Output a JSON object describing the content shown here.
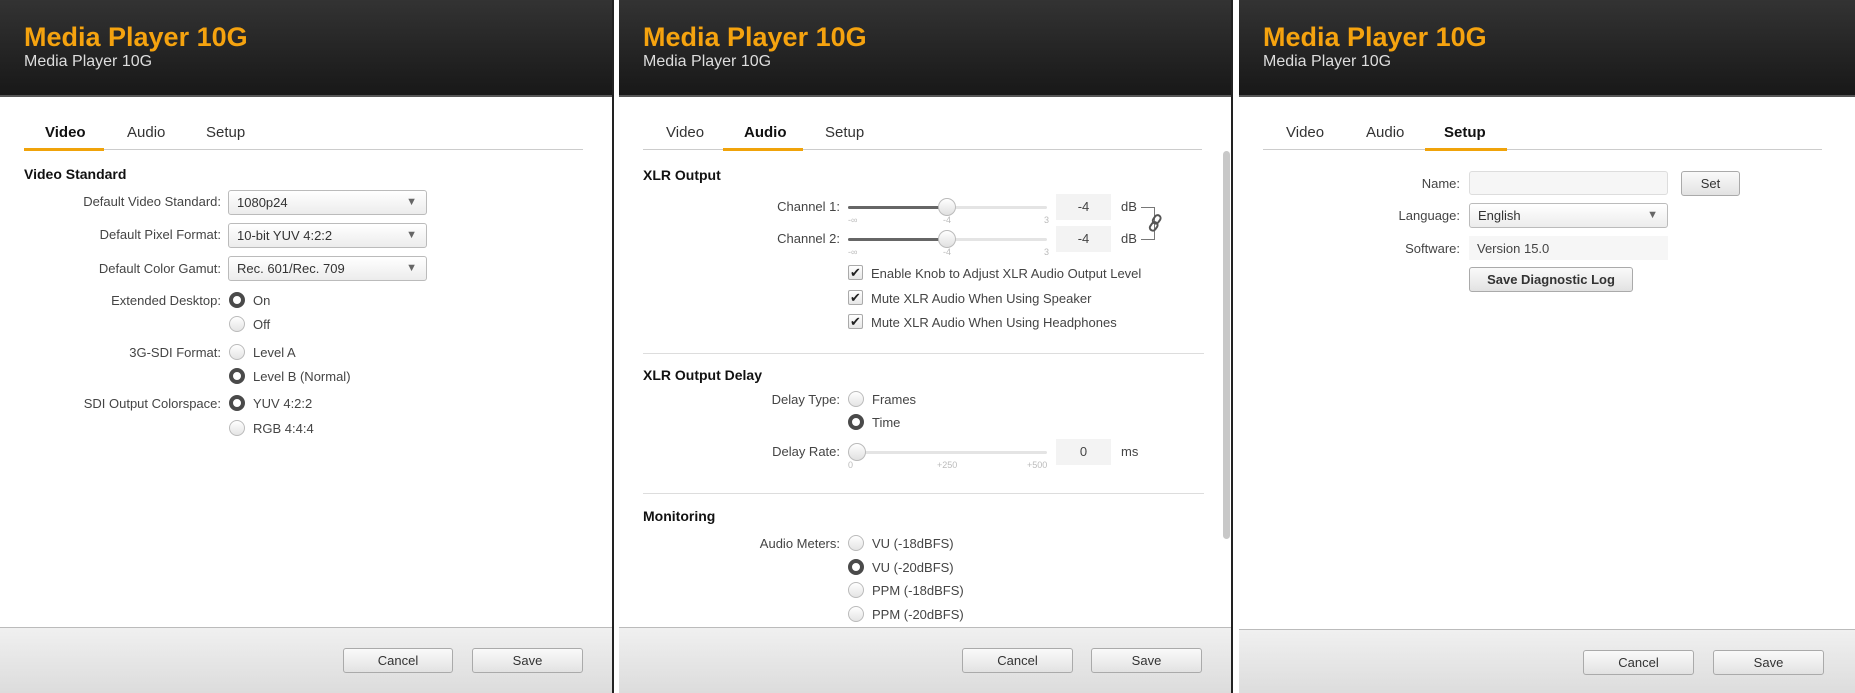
{
  "app": {
    "title": "Media Player 10G",
    "subtitle": "Media Player 10G"
  },
  "tabs": [
    "Video",
    "Audio",
    "Setup"
  ],
  "colors": {
    "accent": "#f0a30a",
    "header_bg": "#222222"
  },
  "footer": {
    "cancel": "Cancel",
    "save": "Save"
  },
  "video": {
    "section": "Video Standard",
    "default_video_standard": {
      "label": "Default Video Standard:",
      "value": "1080p24"
    },
    "default_pixel_format": {
      "label": "Default Pixel Format:",
      "value": "10-bit YUV 4:2:2"
    },
    "default_color_gamut": {
      "label": "Default Color Gamut:",
      "value": "Rec. 601/Rec. 709"
    },
    "extended_desktop": {
      "label": "Extended Desktop:",
      "options": [
        "On",
        "Off"
      ],
      "selected": "On"
    },
    "sdi_format": {
      "label": "3G-SDI Format:",
      "options": [
        "Level A",
        "Level B (Normal)"
      ],
      "selected": "Level B (Normal)"
    },
    "sdi_colorspace": {
      "label": "SDI Output Colorspace:",
      "options": [
        "YUV 4:2:2",
        "RGB 4:4:4"
      ],
      "selected": "YUV 4:2:2"
    }
  },
  "audio": {
    "xlr_output": {
      "section": "XLR Output",
      "channel1": {
        "label": "Channel 1:",
        "value": "-4",
        "unit": "dB",
        "ticks": [
          "-∞",
          "-4",
          "3"
        ]
      },
      "channel2": {
        "label": "Channel 2:",
        "value": "-4",
        "unit": "dB",
        "ticks": [
          "-∞",
          "-4",
          "3"
        ]
      },
      "linked": true,
      "checkboxes": [
        {
          "label": "Enable Knob to Adjust XLR Audio Output Level",
          "checked": true
        },
        {
          "label": "Mute XLR Audio When Using Speaker",
          "checked": true
        },
        {
          "label": "Mute XLR Audio When Using Headphones",
          "checked": true
        }
      ]
    },
    "xlr_delay": {
      "section": "XLR Output Delay",
      "delay_type_label": "Delay Type:",
      "delay_types": [
        "Frames",
        "Time"
      ],
      "selected": "Time",
      "delay_rate_label": "Delay Rate:",
      "delay_rate": "0",
      "unit": "ms",
      "ticks": [
        "0",
        "+250",
        "+500"
      ]
    },
    "monitoring": {
      "section": "Monitoring",
      "label": "Audio Meters:",
      "options": [
        "VU (-18dBFS)",
        "VU (-20dBFS)",
        "PPM (-18dBFS)",
        "PPM (-20dBFS)"
      ],
      "selected": "VU (-20dBFS)"
    }
  },
  "setup": {
    "name": {
      "label": "Name:",
      "value": "",
      "set": "Set"
    },
    "language": {
      "label": "Language:",
      "value": "English"
    },
    "software": {
      "label": "Software:",
      "value": "Version 15.0"
    },
    "save_log": "Save Diagnostic Log"
  }
}
